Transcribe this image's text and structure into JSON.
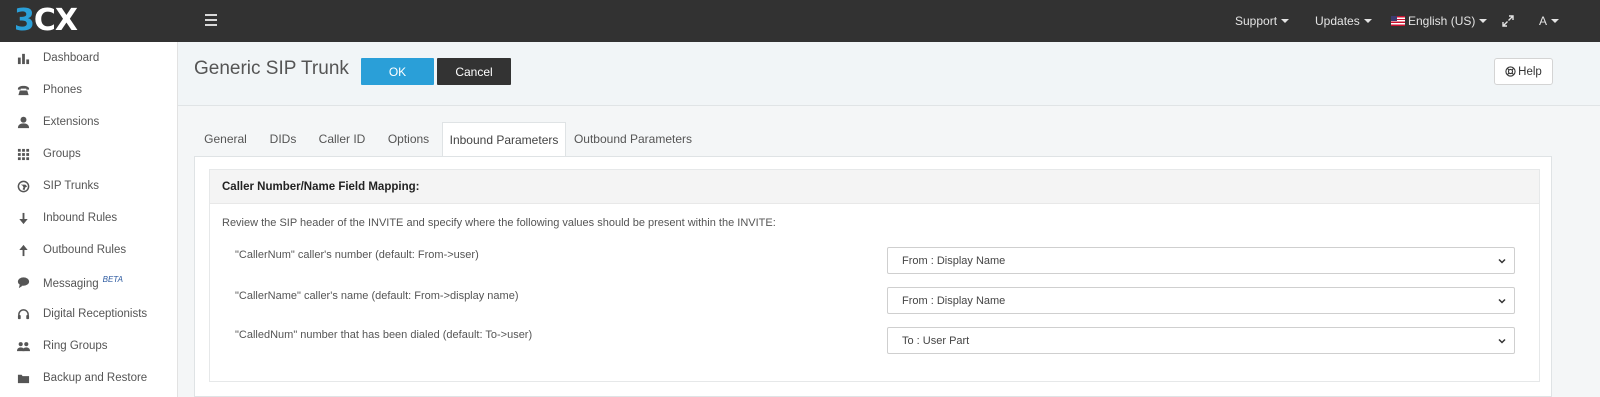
{
  "app": {
    "logo_text": "3CX",
    "logo_accent_color": "#2a9fd8",
    "topbar_color": "#323232"
  },
  "topnav": {
    "support": "Support",
    "updates": "Updates",
    "language": "English (US)",
    "user": "A"
  },
  "sidebar": {
    "items": [
      {
        "label": "Dashboard",
        "icon": "bar-chart-icon"
      },
      {
        "label": "Phones",
        "icon": "phone-icon"
      },
      {
        "label": "Extensions",
        "icon": "user-icon"
      },
      {
        "label": "Groups",
        "icon": "grid-icon"
      },
      {
        "label": "SIP Trunks",
        "icon": "globe-icon"
      },
      {
        "label": "Inbound Rules",
        "icon": "arrow-down-icon"
      },
      {
        "label": "Outbound Rules",
        "icon": "arrow-up-icon"
      },
      {
        "label": "Messaging",
        "icon": "chat-icon",
        "badge": "BETA"
      },
      {
        "label": "Digital Receptionists",
        "icon": "headset-icon"
      },
      {
        "label": "Ring Groups",
        "icon": "users-icon"
      },
      {
        "label": "Backup and Restore",
        "icon": "folder-icon"
      }
    ]
  },
  "header": {
    "title": "Generic SIP Trunk",
    "ok_label": "OK",
    "cancel_label": "Cancel",
    "help_label": "Help"
  },
  "tabs": [
    {
      "label": "General"
    },
    {
      "label": "DIDs"
    },
    {
      "label": "Caller ID"
    },
    {
      "label": "Options"
    },
    {
      "label": "Inbound Parameters",
      "active": true
    },
    {
      "label": "Outbound Parameters"
    }
  ],
  "section": {
    "title": "Caller Number/Name Field Mapping:",
    "description": "Review the SIP header of the INVITE and specify where the following values should be present within the INVITE:",
    "rows": [
      {
        "label": "\"CallerNum\" caller's number (default: From->user)",
        "value": "From : Display Name"
      },
      {
        "label": "\"CallerName\" caller's name (default: From->display name)",
        "value": "From : Display Name"
      },
      {
        "label": "\"CalledNum\" number that has been dialed (default: To->user)",
        "value": "To : User Part"
      }
    ]
  }
}
